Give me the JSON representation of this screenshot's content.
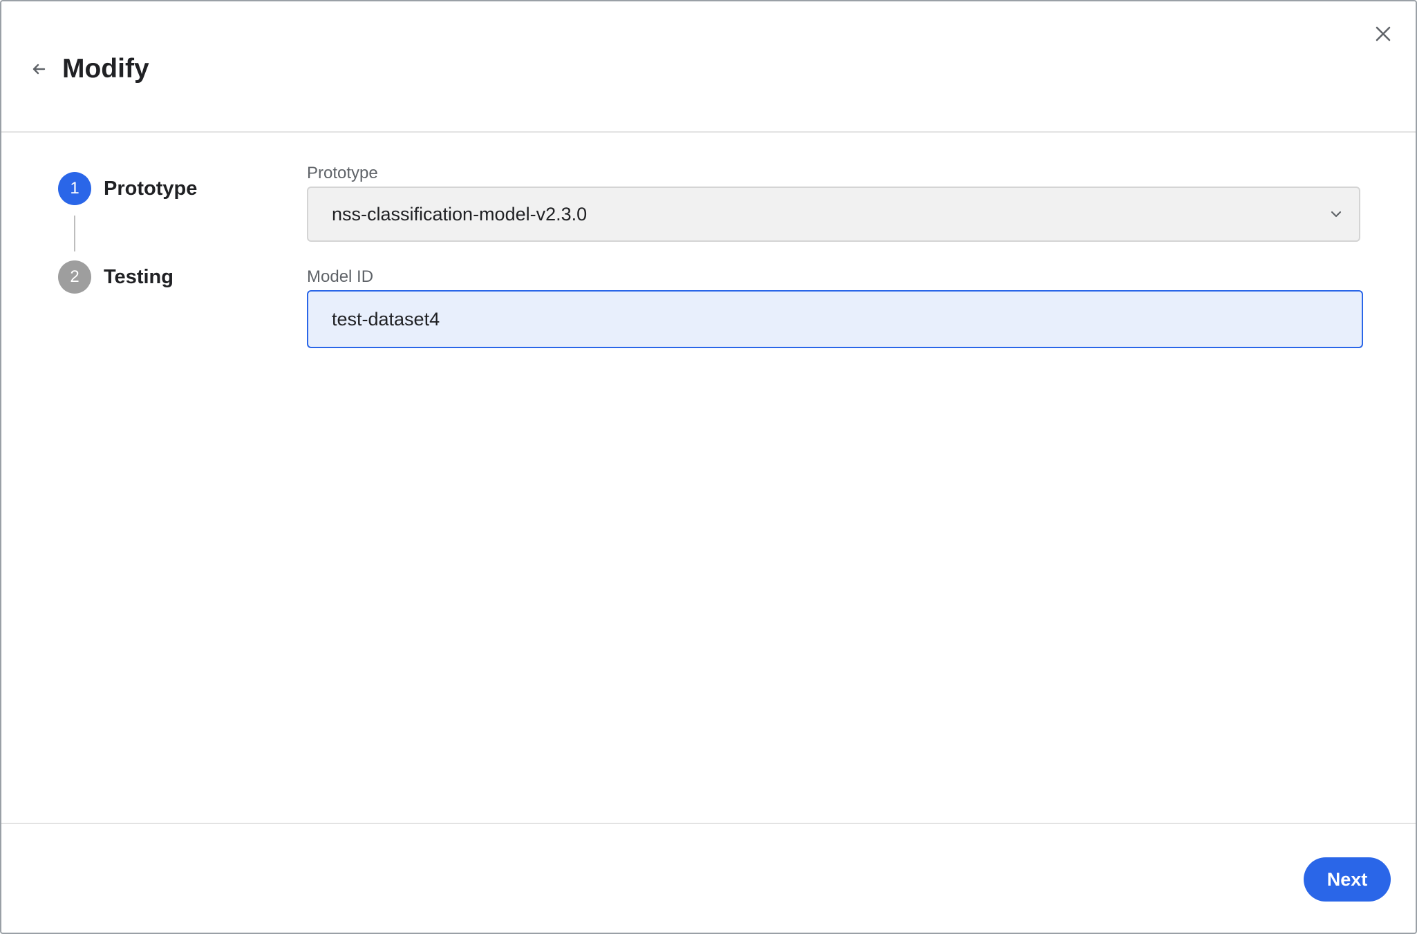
{
  "dialog": {
    "title": "Modify",
    "back_icon": "arrow-left-icon",
    "close_icon": "close-icon"
  },
  "stepper": {
    "steps": [
      {
        "number": "1",
        "label": "Prototype",
        "state": "active"
      },
      {
        "number": "2",
        "label": "Testing",
        "state": "inactive"
      }
    ]
  },
  "form": {
    "prototype": {
      "label": "Prototype",
      "value": "nss-classification-model-v2.3.0",
      "icon": "chevron-down-icon"
    },
    "model_id": {
      "label": "Model ID",
      "value": "test-dataset4"
    }
  },
  "footer": {
    "next_label": "Next"
  },
  "colors": {
    "accent": "#2a66e8",
    "inactive_step": "#9e9e9e",
    "input_focus_bg": "#e8effc",
    "select_bg": "#f1f1f1"
  }
}
